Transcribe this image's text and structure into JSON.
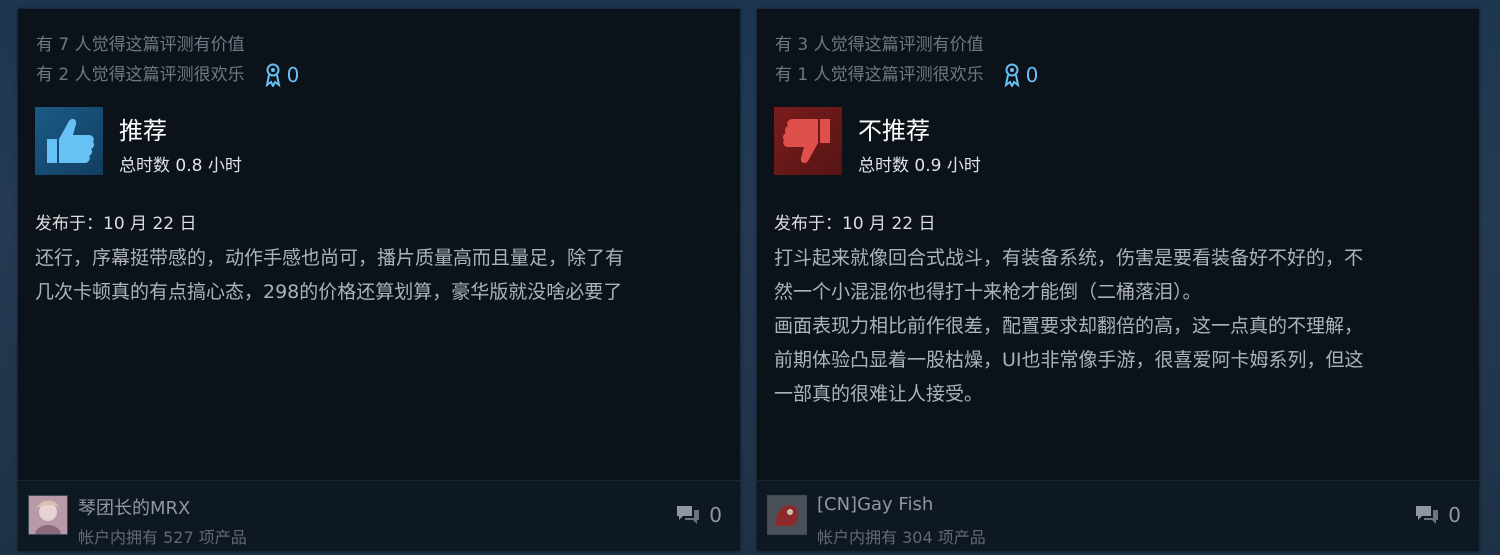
{
  "reviews": [
    {
      "helpful_text": "有 7 人觉得这篇评测有价值",
      "funny_text": "有 2 人觉得这篇评测很欢乐",
      "award_count": "0",
      "verdict": "推荐",
      "recommended": true,
      "hours": "总时数 0.8 小时",
      "posted": "发布于：10 月 22 日",
      "body": [
        "还行，序幕挺带感的，动作手感也尚可，播片质量高而且量足，除了有",
        "几次卡顿真的有点搞心态，298的价格还算划算，豪华版就没啥必要了"
      ],
      "author": "琴团长的MRX",
      "products": "帐户内拥有 527 项产品",
      "comments": "0"
    },
    {
      "helpful_text": "有 3 人觉得这篇评测有价值",
      "funny_text": "有 1 人觉得这篇评测很欢乐",
      "award_count": "0",
      "verdict": "不推荐",
      "recommended": false,
      "hours": "总时数 0.9 小时",
      "posted": "发布于：10 月 22 日",
      "body": [
        "打斗起来就像回合式战斗，有装备系统，伤害是要看装备好不好的，不",
        "然一个小混混你也得打十来枪才能倒（二桶落泪）。",
        "画面表现力相比前作很差，配置要求却翻倍的高，这一点真的不理解，",
        "前期体验凸显着一股枯燥，UI也非常像手游，很喜爱阿卡姆系列，但这",
        "一部真的很难让人接受。"
      ],
      "author": "[CN]Gay Fish",
      "products": "帐户内拥有 304 项产品",
      "comments": "0"
    }
  ],
  "colors": {
    "accent": "#66c0f4",
    "thumbs_up": "#67c1f5",
    "thumbs_down": "#e0504a"
  }
}
